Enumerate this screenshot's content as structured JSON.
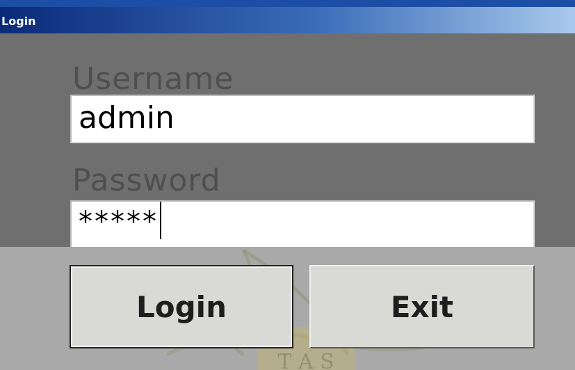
{
  "window": {
    "title": "Login"
  },
  "form": {
    "username_label": "Username",
    "username_value": "admin",
    "password_label": "Password",
    "password_value": "*****"
  },
  "buttons": {
    "login_label": "Login",
    "exit_label": "Exit"
  },
  "watermark": {
    "text": "T A S"
  },
  "colors": {
    "title_bar_start": "#0a2a78",
    "title_bar_end": "#a9c9ec",
    "form_background": "#6f6f6f",
    "button_background": "#d9d9d6"
  }
}
